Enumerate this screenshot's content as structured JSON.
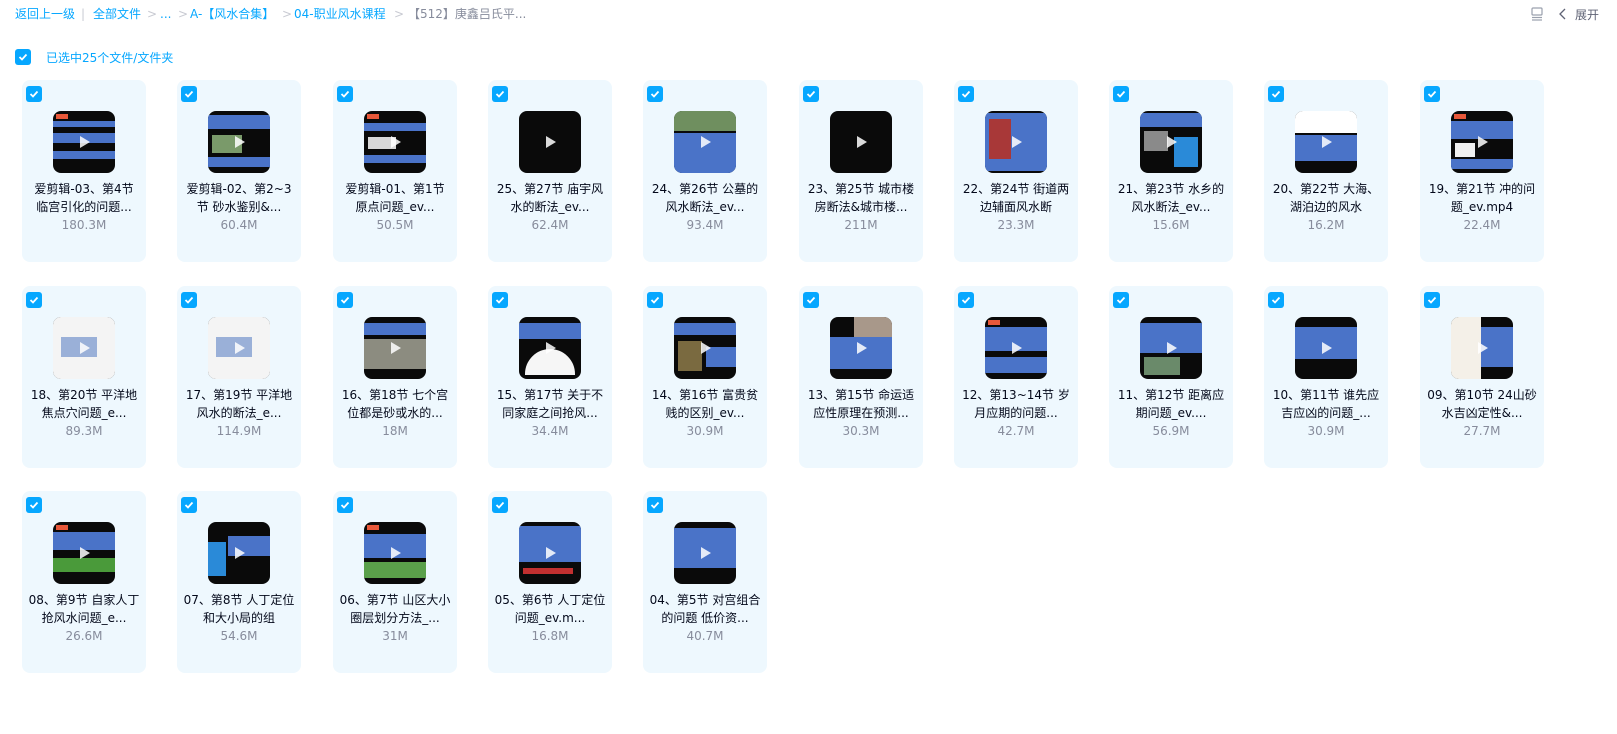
{
  "breadcrumb": {
    "back": "返回上一级",
    "all_files": "全部文件",
    "ellipsis": "...",
    "folder1": "A-【风水合集】",
    "folder2": "04-职业风水课程",
    "current": "【512】庚鑫吕氏平..."
  },
  "toolbar": {
    "expand_label": "展开",
    "list_view_icon": "list-view-icon",
    "collapse_icon": "chevron-left-icon"
  },
  "selection": {
    "text": "已选中25个文件/文件夹",
    "checked": true
  },
  "accent_color": "#06a7ff",
  "files": [
    {
      "name": "爱剪辑-03、第4节 临宫引化的问题...",
      "size": "180.3M",
      "thumb": "a"
    },
    {
      "name": "爱剪辑-02、第2~3节 砂水鉴别&...",
      "size": "60.4M",
      "thumb": "b"
    },
    {
      "name": "爱剪辑-01、第1节 原点问题_ev...",
      "size": "50.5M",
      "thumb": "c"
    },
    {
      "name": "25、第27节 庙宇风水的断法_ev...",
      "size": "62.4M",
      "thumb": "dark"
    },
    {
      "name": "24、第26节 公墓的风水断法_ev...",
      "size": "93.4M",
      "thumb": "d"
    },
    {
      "name": "23、第25节 城市楼房断法&城市楼...",
      "size": "211M",
      "thumb": "dark"
    },
    {
      "name": "22、第24节 街道两边辅面风水断",
      "size": "23.3M",
      "thumb": "e"
    },
    {
      "name": "21、第23节 水乡的风水断法_ev...",
      "size": "15.6M",
      "thumb": "f"
    },
    {
      "name": "20、第22节 大海、湖泊边的风水",
      "size": "16.2M",
      "thumb": "g"
    },
    {
      "name": "19、第21节 冲的问题_ev.mp4",
      "size": "22.4M",
      "thumb": "h"
    },
    {
      "name": "18、第20节 平洋地焦点穴问题_e...",
      "size": "89.3M",
      "thumb": "w"
    },
    {
      "name": "17、第19节 平洋地风水的断法_e...",
      "size": "114.9M",
      "thumb": "w"
    },
    {
      "name": "16、第18节 七个宫位都是砂或水的...",
      "size": "18M",
      "thumb": "i"
    },
    {
      "name": "15、第17节 关于不同家庭之间抢风...",
      "size": "34.4M",
      "thumb": "j"
    },
    {
      "name": "14、第16节 富贵贫贱的区别_ev...",
      "size": "30.9M",
      "thumb": "k"
    },
    {
      "name": "13、第15节 命运适应性原理在预测...",
      "size": "30.3M",
      "thumb": "l"
    },
    {
      "name": "12、第13~14节 岁月应期的问题...",
      "size": "42.7M",
      "thumb": "m"
    },
    {
      "name": "11、第12节 距离应期问题_ev....",
      "size": "56.9M",
      "thumb": "n"
    },
    {
      "name": "10、第11节 谁先应吉应凶的问题_...",
      "size": "30.9M",
      "thumb": "o"
    },
    {
      "name": "09、第10节 24山砂水吉凶定性&...",
      "size": "27.7M",
      "thumb": "p"
    },
    {
      "name": "08、第9节 自家人丁抢风水问题_e...",
      "size": "26.6M",
      "thumb": "q"
    },
    {
      "name": "07、第8节 人丁定位和大小局的组",
      "size": "54.6M",
      "thumb": "r"
    },
    {
      "name": "06、第7节 山区大小圈层划分方法_...",
      "size": "31M",
      "thumb": "s"
    },
    {
      "name": "05、第6节 人丁定位问题_ev.m...",
      "size": "16.8M",
      "thumb": "t"
    },
    {
      "name": "04、第5节 对宫组合的问题 低价资...",
      "size": "40.7M",
      "thumb": "u"
    }
  ]
}
